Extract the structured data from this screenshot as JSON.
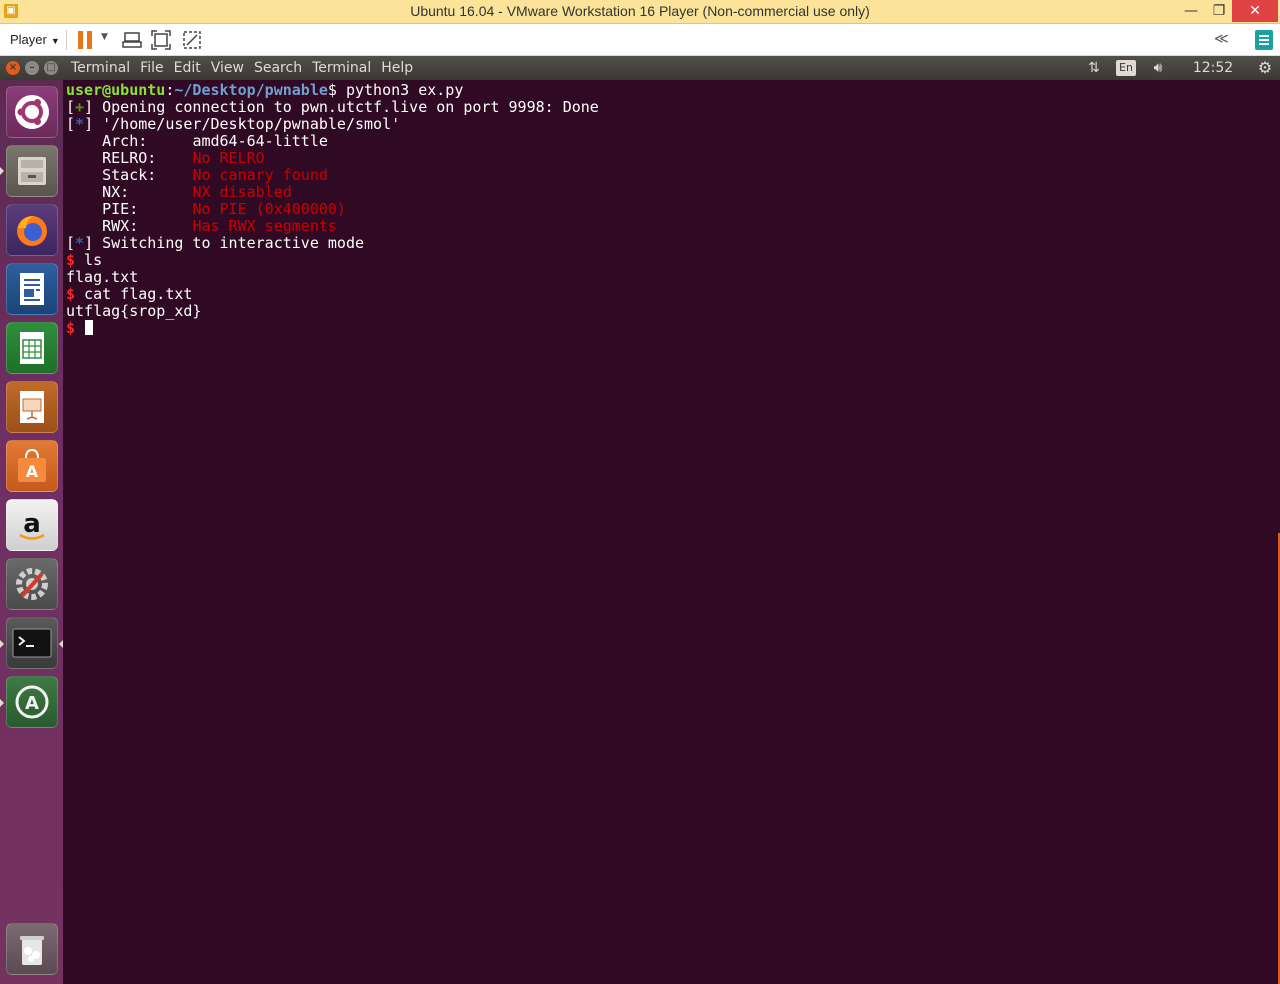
{
  "vmware": {
    "title": "Ubuntu 16.04 - VMware Workstation 16 Player (Non-commercial use only)",
    "player_menu": "Player"
  },
  "ubuntu_panel": {
    "menus": [
      "Terminal",
      "File",
      "Edit",
      "View",
      "Search",
      "Terminal",
      "Help"
    ],
    "keyboard": "En",
    "time": "12:52 AM"
  },
  "launcher": {
    "apps": [
      "ubuntu-dash",
      "files",
      "firefox",
      "libreoffice-writer",
      "libreoffice-calc",
      "libreoffice-impress",
      "ubuntu-software",
      "amazon",
      "system-settings",
      "terminal",
      "software-updater",
      "trash"
    ]
  },
  "terminal": {
    "prompt_user": "user@ubuntu",
    "prompt_sep": ":",
    "prompt_path": "~/Desktop/pwnable",
    "prompt_end": "$ ",
    "command": "python3 ex.py",
    "line_open_tag": "+",
    "line_open_text": " Opening connection to pwn.utctf.live on port 9998: Done",
    "line_path_tag": "*",
    "line_path_text": " '/home/user/Desktop/pwnable/smol'",
    "checksec": [
      {
        "label": "    Arch:     ",
        "value": "amd64-64-little",
        "color": "white"
      },
      {
        "label": "    RELRO:    ",
        "value": "No RELRO",
        "color": "red"
      },
      {
        "label": "    Stack:    ",
        "value": "No canary found",
        "color": "red"
      },
      {
        "label": "    NX:       ",
        "value": "NX disabled",
        "color": "red"
      },
      {
        "label": "    PIE:      ",
        "value": "No PIE (0x400000)",
        "color": "red"
      },
      {
        "label": "    RWX:      ",
        "value": "Has RWX segments",
        "color": "red"
      }
    ],
    "line_interactive_tag": "*",
    "line_interactive_text": " Switching to interactive mode",
    "shell_prompt": "$",
    "cmd1": " ls",
    "out1": "flag.txt",
    "cmd2": " cat flag.txt",
    "out2": "utflag{srop_xd}"
  }
}
